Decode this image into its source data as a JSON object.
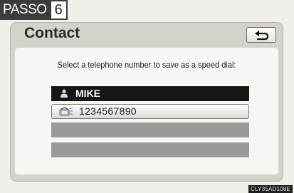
{
  "step": {
    "word": "PASSO",
    "number": "6"
  },
  "header": {
    "title": "Contact"
  },
  "instruction": "Select a telephone number to save as a speed dial:",
  "contact": {
    "name": "MIKE",
    "icon": "person-icon"
  },
  "numbers": [
    {
      "value": "1234567890",
      "icon": "phone-icon"
    }
  ],
  "image_code": "CLY35AD108E",
  "colors": {
    "selected_row": "#161616",
    "empty_row": "#9a9a98",
    "screen_bg": "#d4d2cb"
  }
}
